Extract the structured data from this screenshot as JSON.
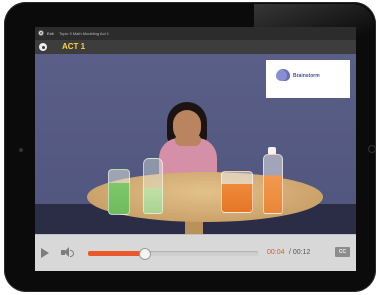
{
  "top_bar": {
    "exit_label": "Exit",
    "title": "Topic 9 Math Modeling Act 1"
  },
  "act_bar": {
    "title": "ACT 1"
  },
  "video": {
    "brand": {
      "name": "Brainstorm",
      "icon": "brain-icon"
    }
  },
  "controls": {
    "current_time": "00:04",
    "total_time": "/ 00:12",
    "cc_label": "CC",
    "progress_fraction": 0.33,
    "accent_color": "#e85a2b"
  }
}
